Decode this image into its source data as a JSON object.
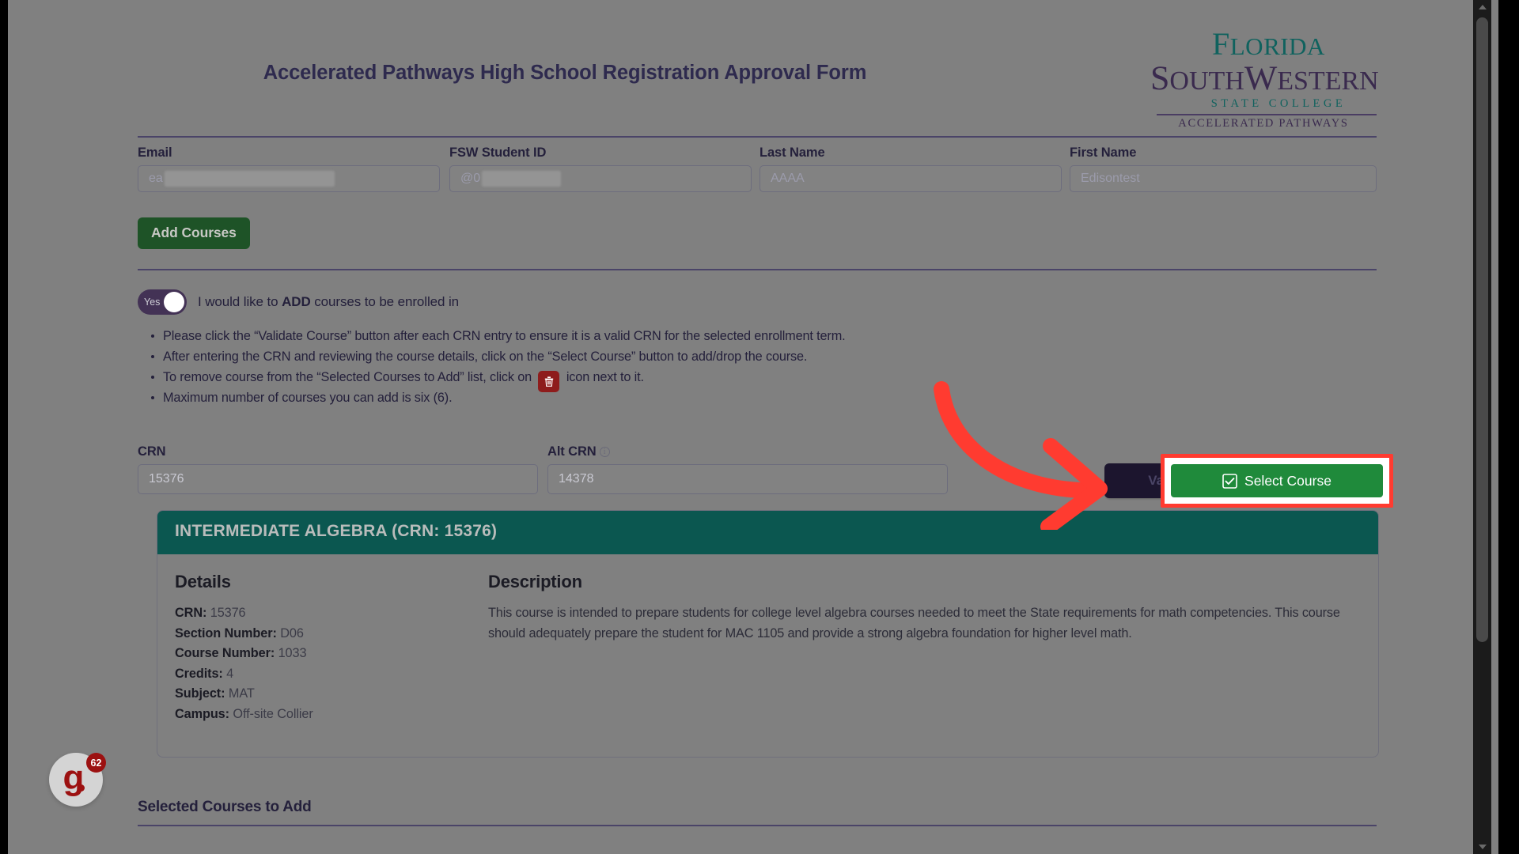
{
  "header": {
    "title": "Accelerated Pathways High School Registration Approval Form"
  },
  "logo": {
    "line1": "Florida",
    "line2": "SouthWestern",
    "line3": "State College",
    "line4": "Accelerated Pathways"
  },
  "student_fields": [
    {
      "label": "Email",
      "value": "ea",
      "redacted": true
    },
    {
      "label": "FSW Student ID",
      "value": "@0",
      "redacted": true
    },
    {
      "label": "Last Name",
      "value": "AAAA",
      "redacted": false
    },
    {
      "label": "First Name",
      "value": "Edisontest",
      "redacted": false
    }
  ],
  "toolbar": {
    "add_courses_label": "Add Courses"
  },
  "toggle": {
    "state_label": "Yes",
    "description_pre": "I would like to ",
    "description_strong": "ADD",
    "description_post": " courses to be enrolled in"
  },
  "instructions": {
    "bullet1": "Please click the “Validate Course” button after each CRN entry to ensure it is a valid CRN for the selected enrollment term.",
    "bullet2": "After entering the CRN and reviewing the course details, click on the “Select Course” button to add/drop the course.",
    "bullet3_pre": "To remove course from the “Selected Courses to Add” list, click on",
    "bullet3_post": "icon next to it.",
    "bullet4": "Maximum number of courses you can add is six (6)."
  },
  "crn_section": {
    "crn_label": "CRN",
    "crn_value": "15376",
    "altcrn_label": "Alt CRN",
    "altcrn_value": "14378",
    "validate_label": "Validate Course",
    "select_label": "Select Course"
  },
  "course_card": {
    "title": "INTERMEDIATE ALGEBRA  (CRN: 15376)",
    "details_heading": "Details",
    "description_heading": "Description",
    "details": [
      {
        "key": "CRN:",
        "value": "15376"
      },
      {
        "key": "Section Number:",
        "value": "D06"
      },
      {
        "key": "Course Number:",
        "value": "1033"
      },
      {
        "key": "Credits:",
        "value": "4"
      },
      {
        "key": "Subject:",
        "value": "MAT"
      },
      {
        "key": "Campus:",
        "value": "Off-site Collier"
      }
    ],
    "description": "This course is intended to prepare students for college level algebra courses needed to meet the State requirements for math competencies. This course should adequately prepare the student for MAC 1105 and provide a strong algebra foundation for higher level math."
  },
  "selected_section": {
    "heading": "Selected Courses to Add"
  },
  "floating_widget": {
    "glyph": "g",
    "badge": "62"
  },
  "colors": {
    "brand_teal": "#0b5750",
    "brand_purple": "#3a2a4e",
    "add_green": "#1e5327",
    "select_green": "#1f8a3b",
    "annotation_red": "#ff3b30",
    "trash_red": "#8e1c1c",
    "validate_navy": "#1c152e"
  }
}
